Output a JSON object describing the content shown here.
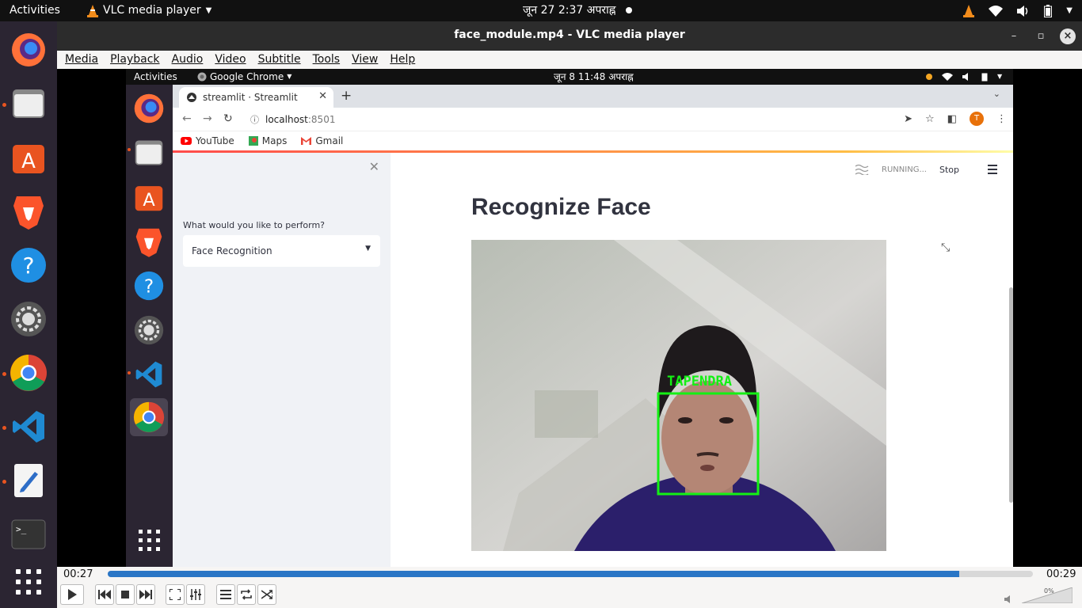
{
  "os_bar": {
    "activities": "Activities",
    "app_name": "VLC media player",
    "clock": "जून 27  2:37 अपराह्न"
  },
  "vlc": {
    "window_title": "face_module.mp4 - VLC media player",
    "menu": [
      "Media",
      "Playback",
      "Audio",
      "Video",
      "Subtitle",
      "Tools",
      "View",
      "Help"
    ],
    "time_elapsed": "00:27",
    "time_total": "00:29",
    "progress": 0.92,
    "volume": "0%"
  },
  "inner": {
    "activities": "Activities",
    "app_name": "Google Chrome",
    "clock": "जून 8  11:48 अपराह्न",
    "chrome": {
      "tab_title": "streamlit · Streamlit",
      "url_host": "localhost",
      "url_port": ":8501",
      "profile_initial": "T",
      "bookmarks": [
        "YouTube",
        "Maps",
        "Gmail"
      ]
    },
    "streamlit": {
      "status": "RUNNING...",
      "stop_label": "Stop",
      "sidebar_label": "What would you like to perform?",
      "select_value": "Face Recognition",
      "page_title": "Recognize Face",
      "face_name": "TAPENDRA"
    }
  }
}
